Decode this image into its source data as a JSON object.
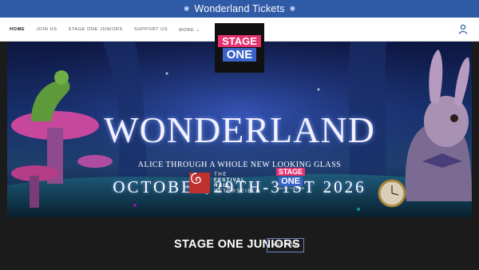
{
  "announcement": {
    "text": "Wonderland Tickets",
    "star_icon": "sparkle-icon"
  },
  "nav": {
    "items": [
      {
        "label": "HOME",
        "active": true
      },
      {
        "label": "JOIN US"
      },
      {
        "label": "STAGE ONE JUNIORS"
      },
      {
        "label": "SUPPORT US"
      },
      {
        "label": "MORE"
      }
    ],
    "account_icon": "user-icon"
  },
  "logo": {
    "line1": "STAGE",
    "line2": "ONE"
  },
  "hero": {
    "title": "WONDERLAND",
    "subtitle": "ALICE THROUGH A WHOLE NEW LOOKING GLASS",
    "dates": "OCTOBER 29TH-31ST 2026",
    "venue": {
      "line1": "THE",
      "line2": "FESTIVAL",
      "line3": "HALL",
      "line4": "PETERSFIELD"
    },
    "youth_logo": {
      "line1": "STAGE",
      "line2": "ONE",
      "line3": "YOUTH THEATRE"
    }
  },
  "section": {
    "title": "STAGE ONE JUNIORS",
    "button_label": "WEB PAGE"
  },
  "colors": {
    "announce_bg": "#2f5aa6",
    "brand_pink": "#e6316f",
    "brand_blue": "#3a63c8",
    "footer_bg": "#1b1b1b"
  }
}
